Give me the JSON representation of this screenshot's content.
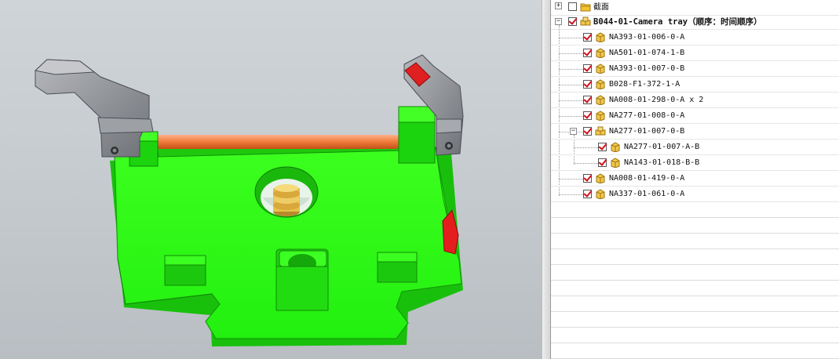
{
  "tree": {
    "section_node": {
      "label": "截面",
      "checked": false,
      "icon": "folder-icon"
    },
    "root_node": {
      "label": "B044-01-Camera tray（顺序：时间顺序）",
      "checked": true,
      "icon": "assembly-icon"
    },
    "components": [
      {
        "label": "NA393-01-006-0-A",
        "checked": true,
        "icon": "part-icon"
      },
      {
        "label": "NA501-01-074-1-B",
        "checked": true,
        "icon": "part-icon"
      },
      {
        "label": "NA393-01-007-0-B",
        "checked": true,
        "icon": "part-icon"
      },
      {
        "label": "B028-F1-372-1-A",
        "checked": true,
        "icon": "part-icon"
      },
      {
        "label": "NA008-01-298-0-A x 2",
        "checked": true,
        "icon": "part-icon"
      },
      {
        "label": "NA277-01-008-0-A",
        "checked": true,
        "icon": "part-icon"
      },
      {
        "label": "NA277-01-007-0-B",
        "checked": true,
        "icon": "assembly-icon"
      },
      {
        "label": "NA277-01-007-A-B",
        "checked": true,
        "icon": "part-icon"
      },
      {
        "label": "NA143-01-018-B-B",
        "checked": true,
        "icon": "part-icon"
      },
      {
        "label": "NA008-01-419-0-A",
        "checked": true,
        "icon": "part-icon"
      },
      {
        "label": "NA337-01-061-0-A",
        "checked": true,
        "icon": "part-icon"
      }
    ]
  },
  "colors": {
    "tray_green": "#22ee11",
    "clip_gray": "#8a8d93",
    "rod_orange": "#ef7a3a",
    "accent_red": "#e41e1e",
    "screw_gold": "#e7c04a"
  }
}
